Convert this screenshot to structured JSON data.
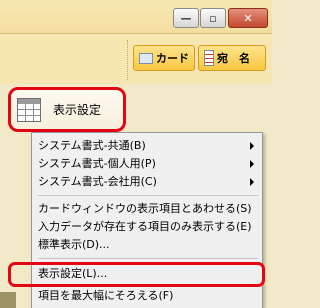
{
  "window_controls": {
    "minimize_icon": "minimize-icon",
    "maximize_icon": "maximize-icon",
    "close_icon": "close-icon",
    "minimize_glyph": "—",
    "maximize_glyph": "▫",
    "close_glyph": "✕"
  },
  "toolbar": {
    "card_label": "カード",
    "address_label": "宛　名"
  },
  "display_settings_button": {
    "label": "表示設定",
    "icon": "table-grid-icon"
  },
  "context_menu": {
    "items": [
      {
        "label": "システム書式-共通(B)",
        "has_submenu": true
      },
      {
        "label": "システム書式-個人用(P)",
        "has_submenu": true
      },
      {
        "label": "システム書式-会社用(C)",
        "has_submenu": true
      },
      {
        "label": "カードウィンドウの表示項目とあわせる(S)",
        "has_submenu": false
      },
      {
        "label": "入力データが存在する項目のみ表示する(E)",
        "has_submenu": false
      },
      {
        "label": "標準表示(D)...",
        "has_submenu": false
      },
      {
        "label": "表示設定(L)...",
        "has_submenu": false
      },
      {
        "label": "項目を最大幅にそろえる(F)",
        "has_submenu": false
      }
    ]
  },
  "colors": {
    "highlight": "#e30613",
    "toolbar_button": "#f6c740",
    "menu_background": "#f0f0f0"
  }
}
